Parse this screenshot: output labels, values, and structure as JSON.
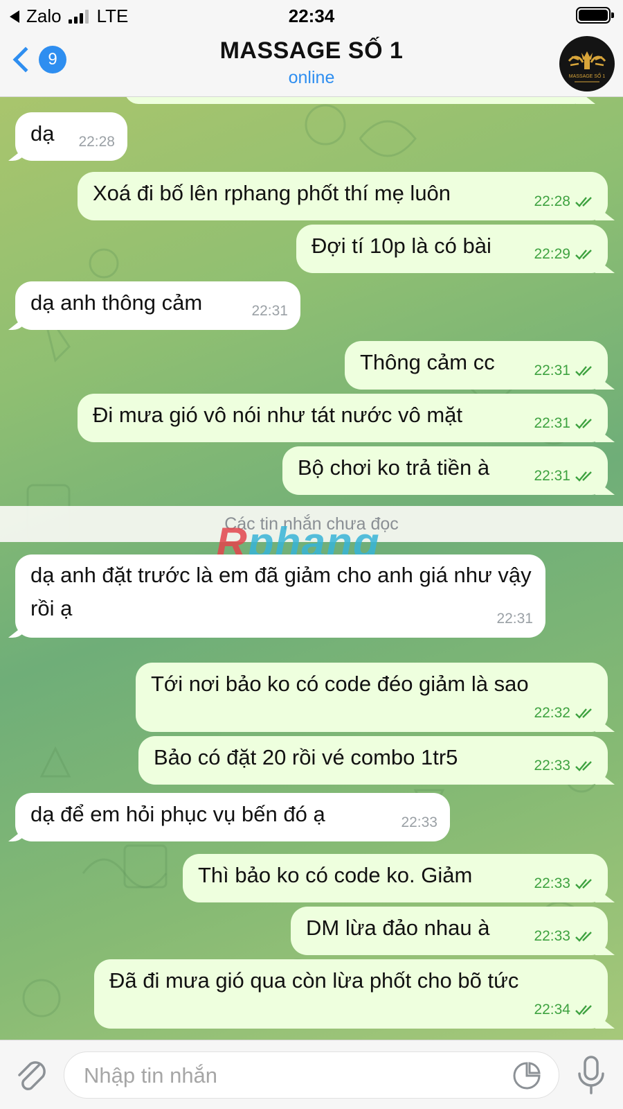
{
  "status_bar": {
    "carrier": "Zalo",
    "network": "LTE",
    "time": "22:34"
  },
  "header": {
    "back_count": "9",
    "title": "MASSAGE SỐ 1",
    "subtitle": "online",
    "avatar_logo": "MASSAGE SỐ 1"
  },
  "chat": {
    "unread_divider": "Các tin nhắn chưa đọc",
    "watermark": {
      "first": "R",
      "rest": "phang"
    },
    "messages": [
      {
        "dir": "in",
        "text": "dạ",
        "time": "22:28"
      },
      {
        "dir": "out",
        "text": "Xoá đi bố lên rphang phốt thí mẹ luôn",
        "time": "22:28"
      },
      {
        "dir": "out",
        "text": "Đợi tí 10p là có bài",
        "time": "22:29"
      },
      {
        "dir": "in",
        "text": "dạ anh thông cảm",
        "time": "22:31"
      },
      {
        "dir": "out",
        "text": "Thông cảm cc",
        "time": "22:31"
      },
      {
        "dir": "out",
        "text": "Đi mưa gió vô nói như tát nước vô mặt",
        "time": "22:31"
      },
      {
        "dir": "out",
        "text": "Bộ chơi ko trả tiền à",
        "time": "22:31"
      },
      {
        "dir": "in",
        "text": "dạ anh đặt trước là em đã giảm cho anh giá như vậy rồi ạ",
        "time": "22:31"
      },
      {
        "dir": "out",
        "text": "Tới nơi bảo ko có code đéo giảm là sao",
        "time": "22:32"
      },
      {
        "dir": "out",
        "text": "Bảo có đặt 20 rồi vé combo 1tr5",
        "time": "22:33"
      },
      {
        "dir": "in",
        "text": "dạ để em hỏi phục vụ bến đó ạ",
        "time": "22:33"
      },
      {
        "dir": "out",
        "text": "Thì bảo ko có code ko. Giảm",
        "time": "22:33"
      },
      {
        "dir": "out",
        "text": "DM lừa đảo nhau à",
        "time": "22:33"
      },
      {
        "dir": "out",
        "text": "Đã đi mưa gió qua còn lừa phốt cho bõ tức",
        "time": "22:34"
      }
    ]
  },
  "input_bar": {
    "placeholder": "Nhập tin nhắn"
  },
  "colors": {
    "accent": "#2e8ef0",
    "outgoing_bubble": "#eeffde",
    "incoming_bubble": "#ffffff",
    "read_check": "#3ea240"
  },
  "icons": {
    "back": "chevron-left-icon",
    "attach": "paperclip-icon",
    "sticker": "sticker-icon",
    "mic": "microphone-icon"
  }
}
